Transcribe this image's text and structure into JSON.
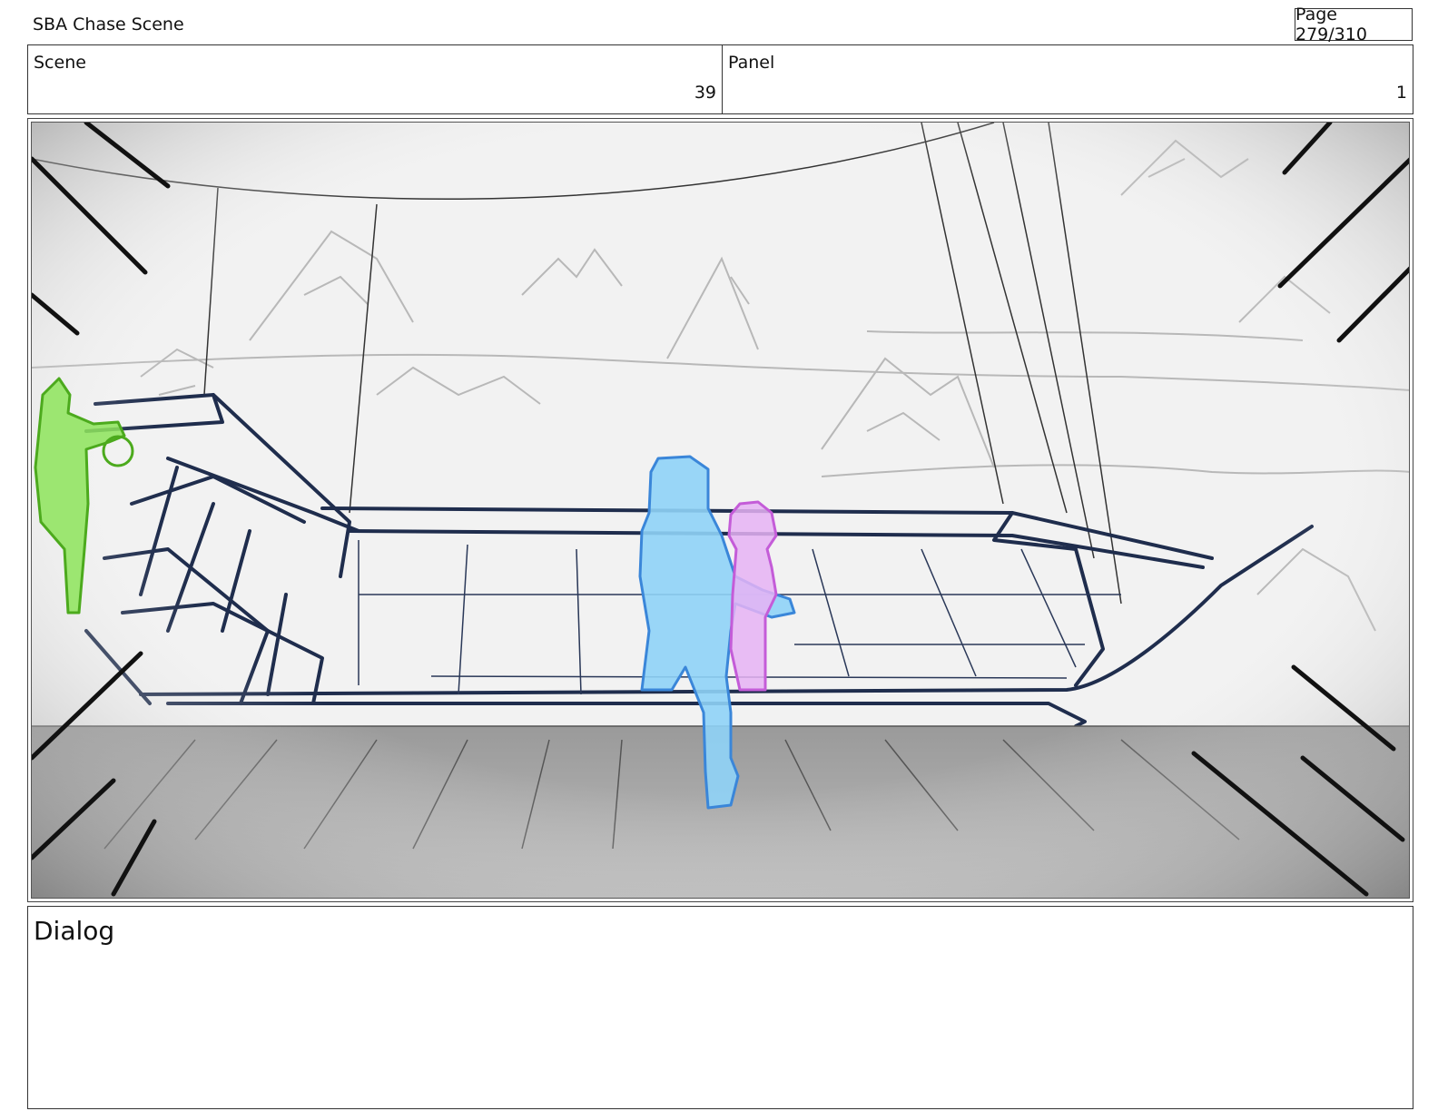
{
  "header": {
    "title": "SBA Chase Scene",
    "page": "Page 279/310"
  },
  "info": {
    "scene_label": "Scene",
    "scene_value": "39",
    "panel_label": "Panel",
    "panel_value": "1"
  },
  "dialog": {
    "label": "Dialog"
  },
  "colors": {
    "boat_ink": "#1f2d4d",
    "character_blue": "#8fd3f7",
    "character_pink": "#e6b3f5",
    "character_green": "#8de45a"
  }
}
